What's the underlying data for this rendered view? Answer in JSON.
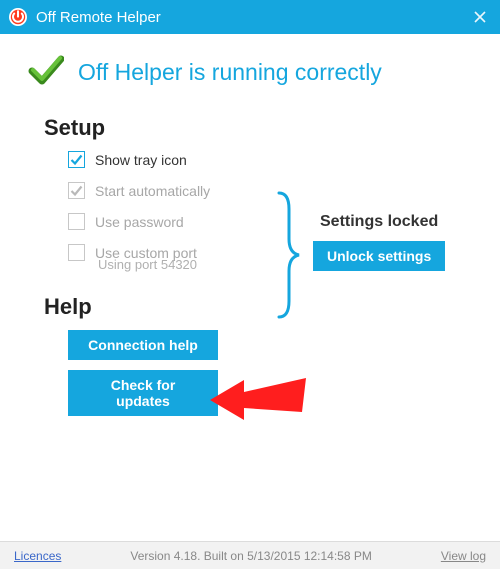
{
  "window": {
    "title": "Off Remote Helper"
  },
  "status": {
    "message": "Off Helper is running correctly"
  },
  "sections": {
    "setup": "Setup",
    "help": "Help"
  },
  "options": {
    "tray": {
      "label": "Show tray icon",
      "checked": true,
      "enabled": true
    },
    "auto": {
      "label": "Start automatically",
      "checked": true,
      "enabled": false
    },
    "pass": {
      "label": "Use password",
      "checked": false,
      "enabled": false
    },
    "port": {
      "label": "Use custom port",
      "checked": false,
      "enabled": false
    },
    "port_note": "Using port 54320"
  },
  "locked": {
    "title": "Settings locked",
    "unlock_btn": "Unlock settings"
  },
  "help": {
    "connection_btn": "Connection help",
    "updates_btn": "Check for updates"
  },
  "footer": {
    "licences": "Licences",
    "version": "Version 4.18. Built on 5/13/2015 12:14:58 PM",
    "viewlog": "View log"
  },
  "colors": {
    "accent": "#15a6de",
    "arrow": "#ff1e1e"
  }
}
